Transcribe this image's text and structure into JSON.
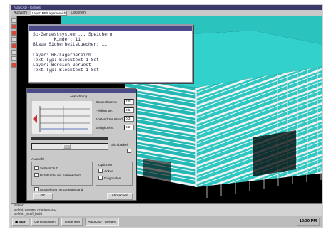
{
  "text_window": {
    "lines": [
      "Sc-Geruestsystem ... Speichern",
      "        Kinder: 11",
      "Blaue Sicherheitstuecher: 11",
      "",
      "Layer: RB/Lagerbereich",
      "Text Typ: Blocktext 1 Set",
      "Layer: Bereich-Geruest",
      "Text Typ: Blocktext 1 Set"
    ]
  },
  "dialog": {
    "title": "Ausrichtung",
    "field1_label": "Geruesthoehe:",
    "field1_value": "2.0",
    "field2_label": "Feldlaenge:",
    "field2_value": "2.5",
    "field3_label": "Abstand zur Wand:",
    "field3_value": "0.3",
    "field4_label": "Belaghoehe:",
    "field4_value": "0.2",
    "mid_label": "Sichtbarkeit",
    "group_label": "Auswahl",
    "options_label": "Optionen",
    "cb1_label": "Seitenschutz",
    "cb2_label": "Bordbretter mit Seitenschutz",
    "cb3_label": "Anker",
    "cb4_label": "Diagonalen",
    "cb5_label": "Aussteifung mit Gitterabstand",
    "ok_label": "OK",
    "cancel_label": "Abbrechen"
  },
  "command_lines": [
    "Befehl:",
    "Befehl:  Geruest  Arbeitsschutz",
    "Befehl: _scaff_build"
  ],
  "taskbar": {
    "start": "Start",
    "items": [
      "Geruestsystem",
      "Textfenster",
      "AutoCAD - Geruest"
    ],
    "clock": "12:30 PM"
  },
  "colors": {
    "facade_cyan": "#2ec8c3",
    "scaffold_white": "#f2f2f2",
    "window_title": "#4a4a88"
  },
  "icons": [
    "start-icon",
    "tool-icon",
    "checkbox-icon"
  ]
}
